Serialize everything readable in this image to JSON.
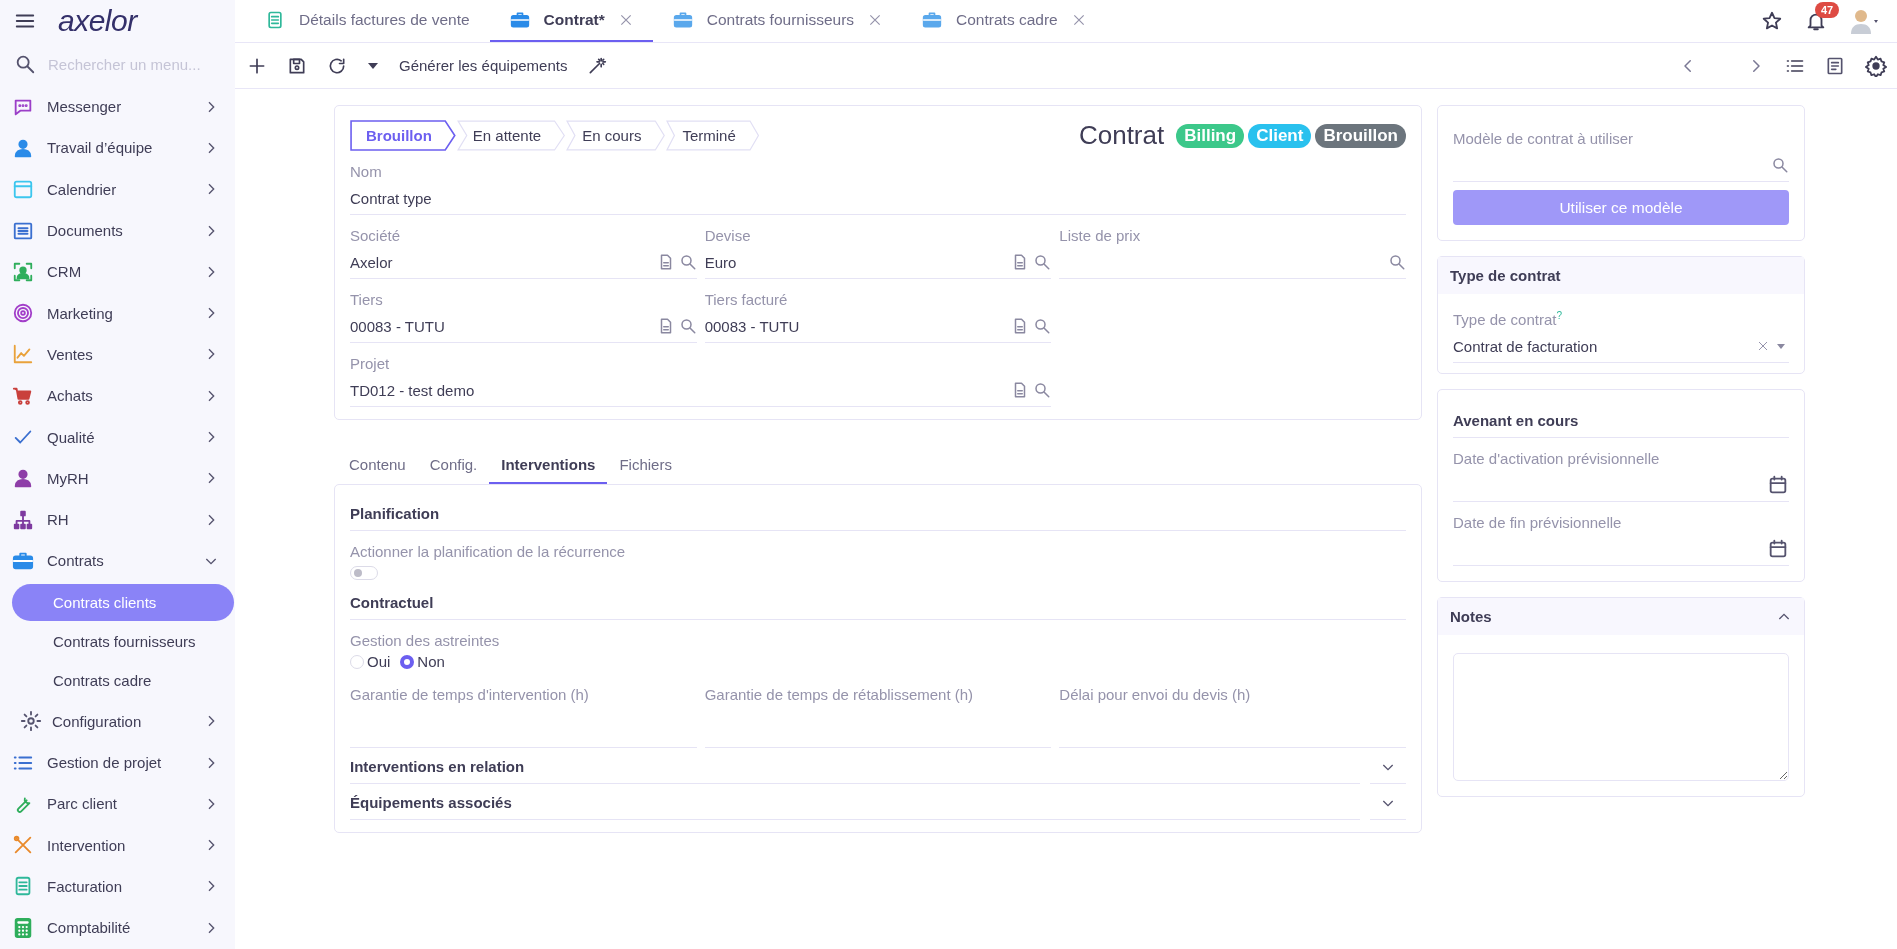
{
  "app": {
    "logo": "axelor"
  },
  "sidebar": {
    "search": {
      "placeholder": "Rechercher un menu..."
    },
    "items": [
      {
        "label": "Messenger",
        "expanded": false
      },
      {
        "label": "Travail d’équipe",
        "expanded": false
      },
      {
        "label": "Calendrier",
        "expanded": false
      },
      {
        "label": "Documents",
        "expanded": false
      },
      {
        "label": "CRM",
        "expanded": false
      },
      {
        "label": "Marketing",
        "expanded": false
      },
      {
        "label": "Ventes",
        "expanded": false
      },
      {
        "label": "Achats",
        "expanded": false
      },
      {
        "label": "Qualité",
        "expanded": false
      },
      {
        "label": "MyRH",
        "expanded": false
      },
      {
        "label": "RH",
        "expanded": false
      },
      {
        "label": "Contrats",
        "expanded": true,
        "children": [
          {
            "label": "Contrats clients",
            "selected": true
          },
          {
            "label": "Contrats fournisseurs",
            "selected": false
          },
          {
            "label": "Contrats cadre",
            "selected": false
          },
          {
            "label": "Configuration",
            "selected": false,
            "expanded": false
          }
        ]
      },
      {
        "label": "Gestion de projet",
        "expanded": false
      },
      {
        "label": "Parc client",
        "expanded": false
      },
      {
        "label": "Intervention",
        "expanded": false
      },
      {
        "label": "Facturation",
        "expanded": false
      },
      {
        "label": "Comptabilité",
        "expanded": false
      }
    ]
  },
  "tabs": [
    {
      "label": "Détails factures de vente",
      "selected": false,
      "closable": false
    },
    {
      "label": "Contrat*",
      "selected": true,
      "closable": true
    },
    {
      "label": "Contrats fournisseurs",
      "selected": false,
      "closable": true
    },
    {
      "label": "Contrats cadre",
      "selected": false,
      "closable": true
    }
  ],
  "notifications": {
    "count": "47"
  },
  "toolbar": {
    "action": "Générer les équipements"
  },
  "form": {
    "steps": [
      {
        "label": "Brouillon",
        "selected": true
      },
      {
        "label": "En attente",
        "selected": false
      },
      {
        "label": "En cours",
        "selected": false
      },
      {
        "label": "Terminé",
        "selected": false
      }
    ],
    "title": "Contrat",
    "badges": [
      {
        "label": "Billing",
        "color": "#3cc88a"
      },
      {
        "label": "Client",
        "color": "#29c1ee"
      },
      {
        "label": "Brouillon",
        "color": "#6c757d"
      }
    ],
    "name": {
      "label": "Nom",
      "value": "Contrat type"
    },
    "fields": [
      {
        "label": "Société",
        "value": "Axelor",
        "kind": "relation"
      },
      {
        "label": "Devise",
        "value": "Euro",
        "kind": "relation"
      },
      {
        "label": "Liste de prix",
        "kind": "search"
      },
      {
        "label": "Tiers",
        "value": "00083 - TUTU",
        "kind": "relation"
      },
      {
        "label": "Tiers facturé",
        "value": "00083 - TUTU",
        "kind": "relation"
      },
      {
        "label": "Projet",
        "value": "TD012 - test demo",
        "kind": "relation",
        "wide": true
      }
    ]
  },
  "form_tabs": [
    {
      "label": "Contenu",
      "selected": false
    },
    {
      "label": "Config.",
      "selected": false
    },
    {
      "label": "Interventions",
      "selected": true
    },
    {
      "label": "Fichiers",
      "selected": false
    }
  ],
  "panel": {
    "blocks": [
      {
        "kind": "section",
        "title": "Planification"
      },
      {
        "kind": "toggle",
        "label": "Actionner la planification de la récurrence",
        "on": false
      },
      {
        "kind": "section",
        "title": "Contractuel"
      },
      {
        "kind": "radio",
        "label": "Gestion des astreintes",
        "options": [
          {
            "label": "Oui",
            "selected": false
          },
          {
            "label": "Non",
            "selected": true
          }
        ]
      },
      {
        "kind": "fields",
        "fields": [
          {
            "label": "Garantie de temps d'intervention (h)"
          },
          {
            "label": "Garantie de temps de rétablissement (h)"
          },
          {
            "label": "Délai pour envoi du devis (h)"
          }
        ]
      },
      {
        "kind": "collapsible",
        "title": "Interventions en relation",
        "expanded": false
      },
      {
        "kind": "collapsible",
        "title": "Équipements associés",
        "expanded": false
      }
    ]
  },
  "template": {
    "label": "Modèle de contrat à utiliser",
    "button": "Utiliser ce modèle"
  },
  "contract_type": {
    "title": "Type de contrat",
    "label": "Type de contrat",
    "help": "?",
    "value": "Contrat de facturation"
  },
  "amendment": {
    "title": "Avenant en cours",
    "fields": [
      {
        "label": "Date d'activation prévisionnelle"
      },
      {
        "label": "Date de fin prévisionnelle"
      }
    ]
  },
  "notes": {
    "title": "Notes",
    "expanded": true
  }
}
